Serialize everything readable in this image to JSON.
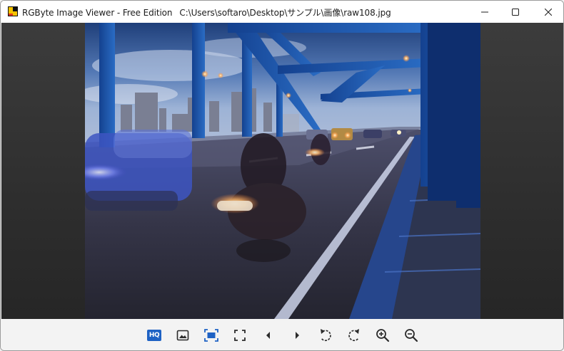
{
  "window": {
    "app_name": "RGByte Image Viewer - Free Edition",
    "file_path": "C:\\Users\\softaro\\Desktop\\サンプル\\画像\\raw108.jpg"
  },
  "toolbar": {
    "hq_label": "HQ",
    "tools": [
      "hq-toggle",
      "image-icon",
      "fit-to-window-icon",
      "fullscreen-icon",
      "previous-icon",
      "next-icon",
      "rotate-left-icon",
      "rotate-right-icon",
      "zoom-in-icon",
      "zoom-out-icon"
    ]
  },
  "colors": {
    "accent": "#1e62c4",
    "viewport_bg": "#2f2f2f",
    "titlebar_bg": "#ffffff",
    "toolbar_bg": "#f3f3f3"
  }
}
